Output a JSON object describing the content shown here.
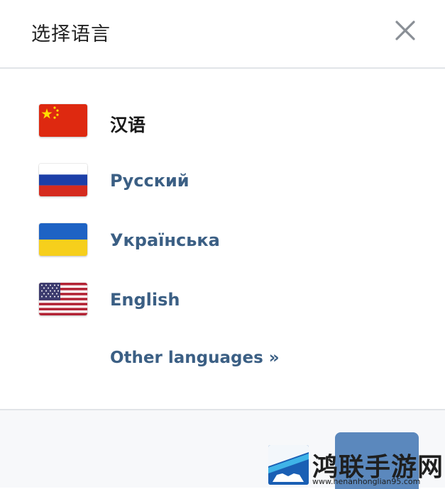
{
  "dialog": {
    "title": "选择语言",
    "close_icon": "close-icon"
  },
  "languages": [
    {
      "label": "汉语",
      "flag": "china-flag-icon",
      "current": true
    },
    {
      "label": "Русский",
      "flag": "russia-flag-icon",
      "current": false
    },
    {
      "label": "Українська",
      "flag": "ukraine-flag-icon",
      "current": false
    },
    {
      "label": "English",
      "flag": "usa-flag-icon",
      "current": false
    }
  ],
  "other_languages": "Other languages »",
  "colors": {
    "link": "#3b5f84",
    "current_text": "#1a1a1a",
    "divider": "#e1e4e8",
    "button": "#5b88bd"
  },
  "watermark": {
    "name": "鸿联手游网",
    "url": "www.henanhonglian95.com"
  }
}
